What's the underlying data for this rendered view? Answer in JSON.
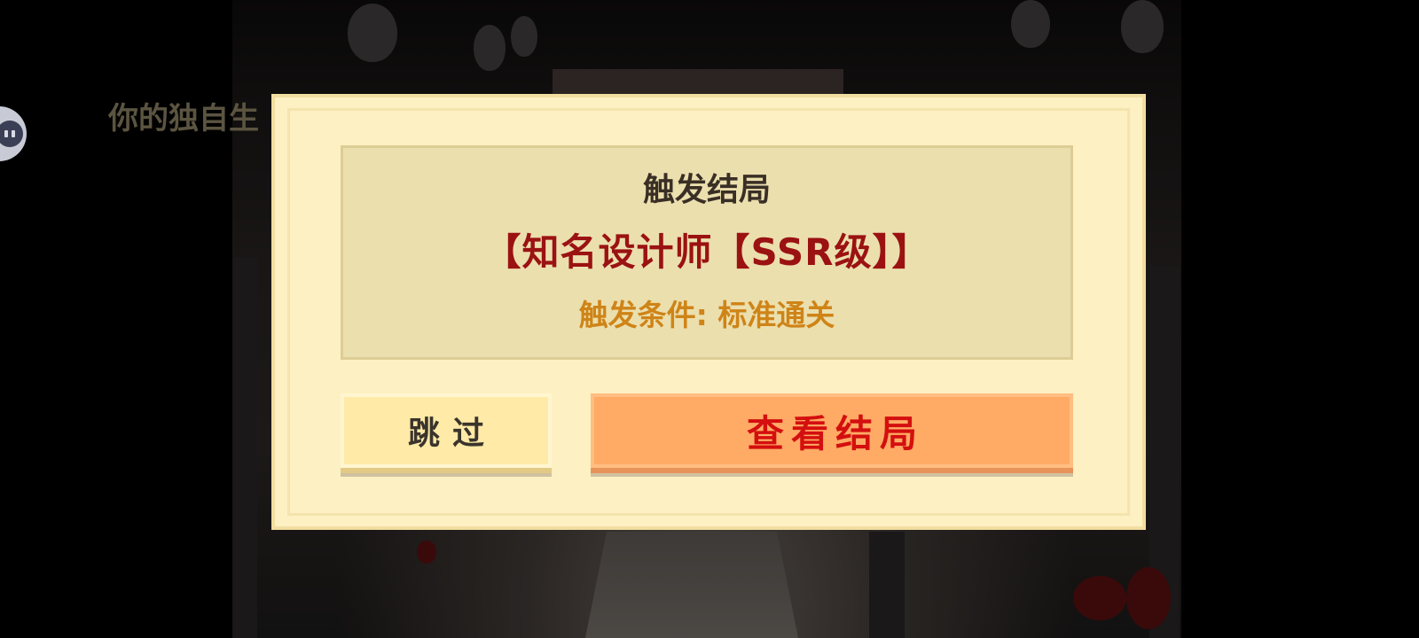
{
  "background": {
    "caption": "你的独自生"
  },
  "dialog": {
    "title": "触发结局",
    "ending_name": "【知名设计师【SSR级】】",
    "trigger_condition": "触发条件: 标准通关",
    "skip_label": "跳过",
    "view_label": "查看结局"
  },
  "icons": {
    "side_chat": "chat-bubble-icon"
  },
  "colors": {
    "dialog_bg": "#fdf0c2",
    "panel_bg": "#ebdfae",
    "ending_name": "#9b1212",
    "condition_text": "#cf8417",
    "skip_button": "#ffeaa7",
    "view_button": "#ffab65",
    "view_button_text": "#d40f0f"
  }
}
